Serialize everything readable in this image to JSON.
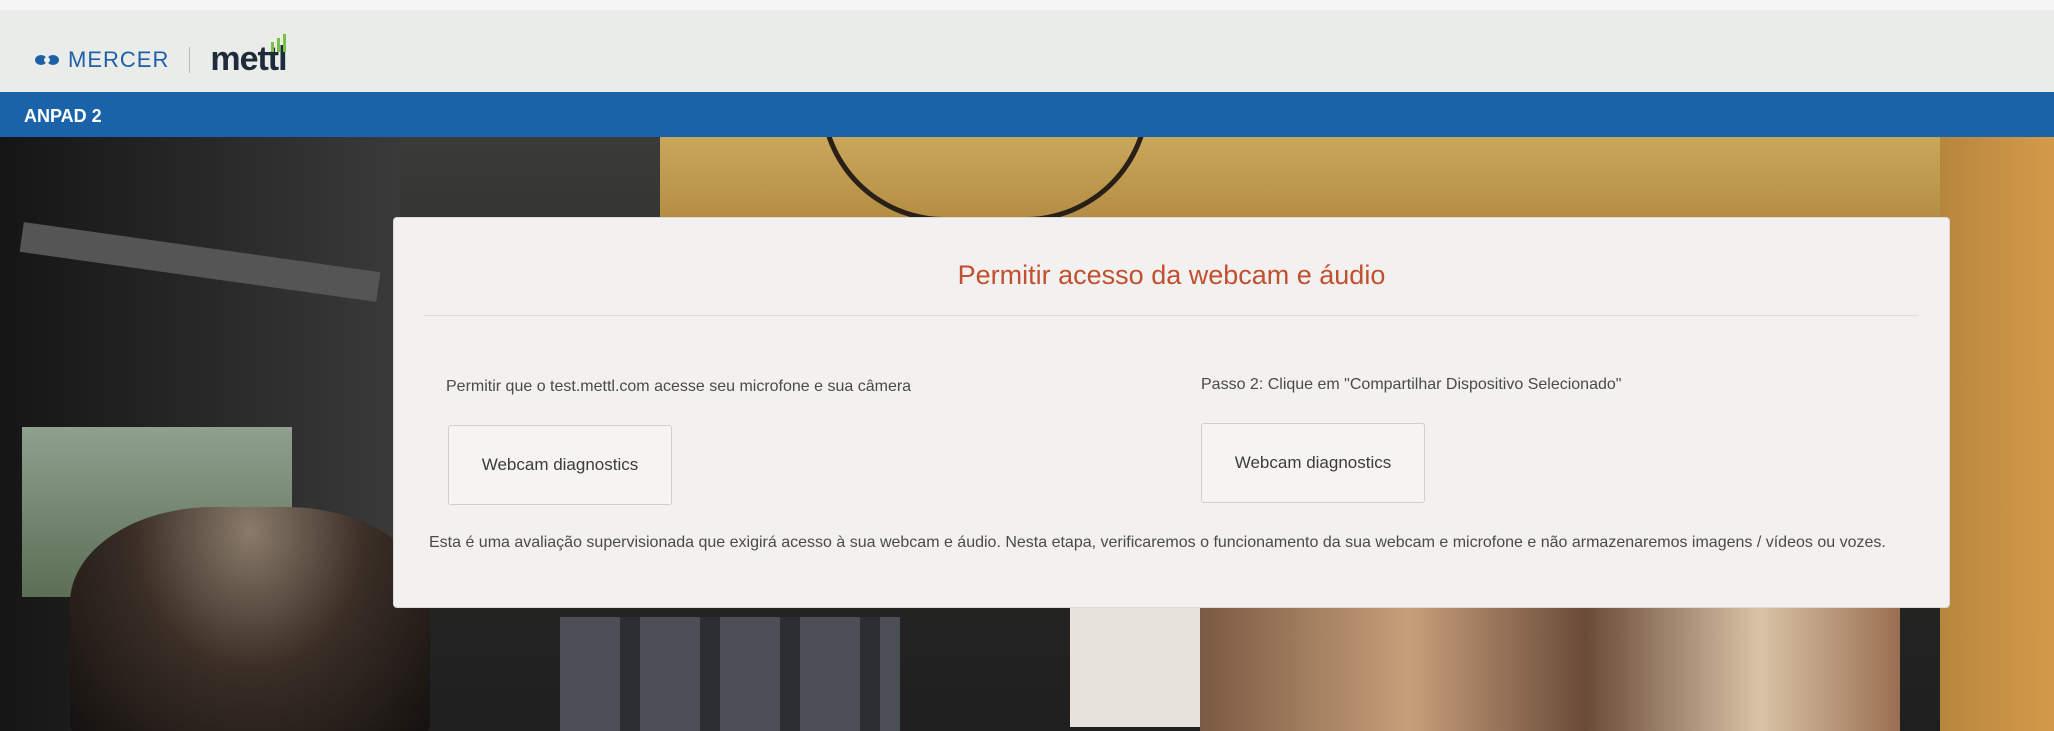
{
  "header": {
    "brand_mercer": "MERCER",
    "brand_mettl": "mettl"
  },
  "nav": {
    "exam_title": "ANPAD 2"
  },
  "dialog": {
    "title": "Permitir acesso da webcam e áudio",
    "step1_text": "Permitir que o test.mettl.com acesse seu microfone e sua câmera",
    "step1_button": "Webcam diagnostics",
    "step2_text": "Passo 2: Clique em \"Compartilhar Dispositivo Selecionado\"",
    "step2_button": "Webcam diagnostics",
    "info_text": "Esta é uma avaliação supervisionada que exigirá acesso à sua webcam e áudio. Nesta etapa, verificaremos o funcionamento da sua webcam e microfone e não armazenaremos imagens / vídeos ou vozes."
  },
  "colors": {
    "nav_bar": "#1b63a8",
    "title_accent": "#c0502f",
    "mercer_blue": "#1f5fa8"
  }
}
